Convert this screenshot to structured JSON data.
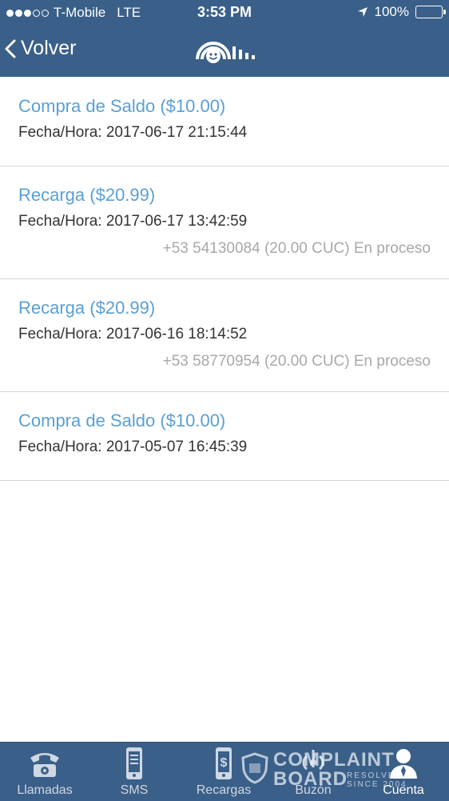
{
  "status_bar": {
    "carrier": "T-Mobile",
    "network": "LTE",
    "time": "3:53 PM",
    "battery": "100%"
  },
  "header": {
    "back_label": "Volver",
    "logo_icon": "smiley-signal-logo-icon"
  },
  "transactions": [
    {
      "title": "Compra de Saldo ($10.00)",
      "date": "Fecha/Hora: 2017-06-17 21:15:44",
      "extra": ""
    },
    {
      "title": "Recarga ($20.99)",
      "date": "Fecha/Hora: 2017-06-17 13:42:59",
      "extra": "+53 54130084 (20.00 CUC) En proceso"
    },
    {
      "title": "Recarga ($20.99)",
      "date": "Fecha/Hora: 2017-06-16 18:14:52",
      "extra": "+53 58770954 (20.00 CUC) En proceso"
    },
    {
      "title": "Compra de Saldo ($10.00)",
      "date": "Fecha/Hora: 2017-05-07 16:45:39",
      "extra": ""
    }
  ],
  "tabbar": {
    "tabs": [
      {
        "label": "Llamadas",
        "icon": "telephone-icon"
      },
      {
        "label": "SMS",
        "icon": "phone-device-icon"
      },
      {
        "label": "Recargas",
        "icon": "phone-dollar-icon"
      },
      {
        "label": "Buzón",
        "icon": "voicemail-icon"
      },
      {
        "label": "Cuenta",
        "icon": "user-icon"
      }
    ],
    "active": "Cuenta"
  },
  "watermark": {
    "line1": "COMPLAINT",
    "line2": "BOARD",
    "tag1": "RESOLVE",
    "tag2": "SINCE 2004"
  },
  "colors": {
    "header_bg": "#3a5f88",
    "title_blue": "#5a9fd4",
    "muted": "#a8a8a8"
  }
}
